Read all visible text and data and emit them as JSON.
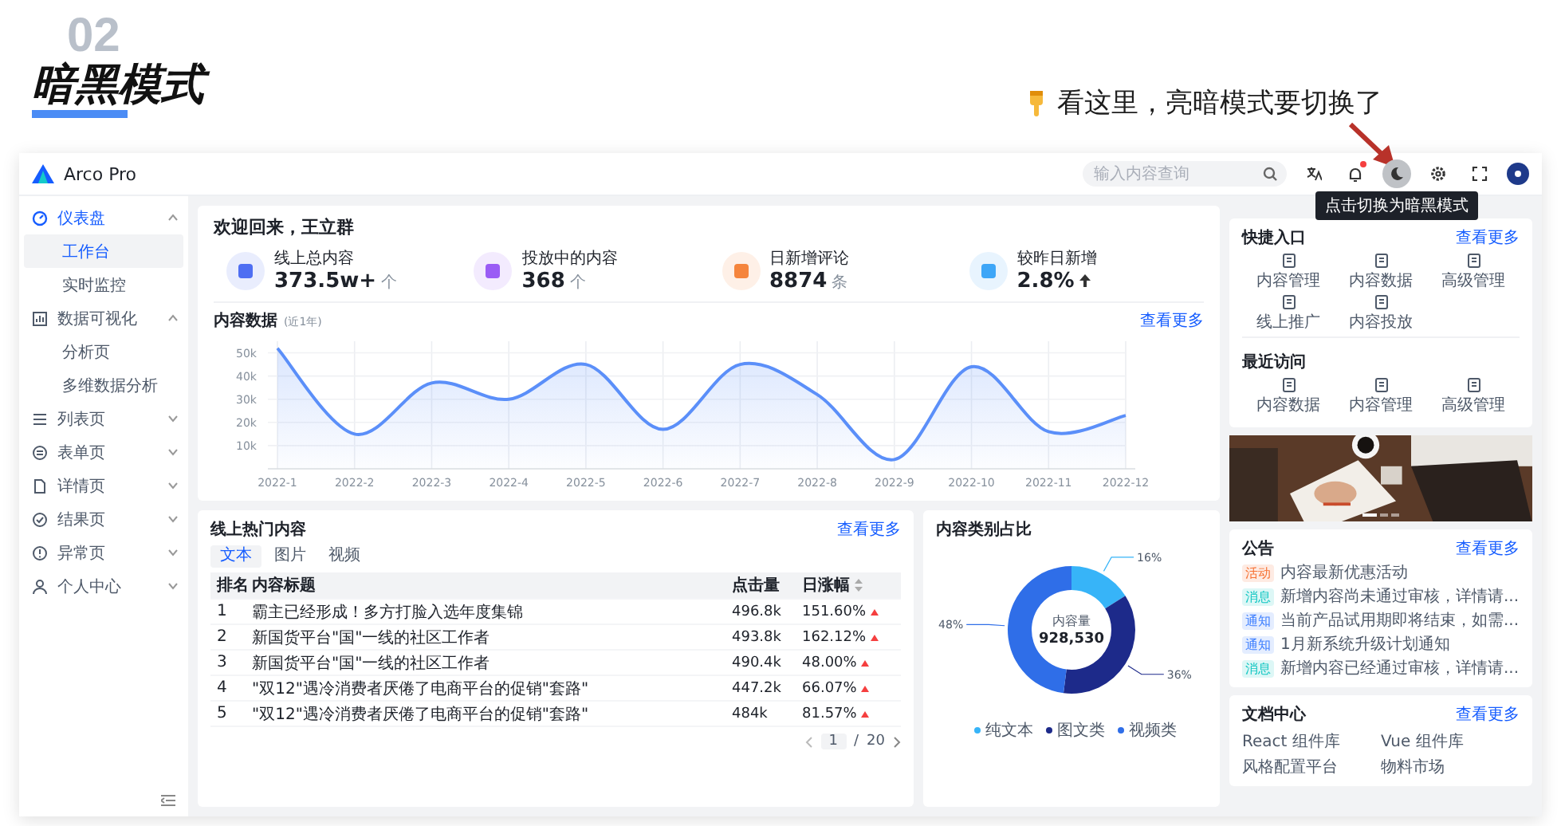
{
  "slide": {
    "section_number": "02",
    "title": "暗黑模式",
    "annotation": "看这里，亮暗模式要切换了"
  },
  "app": {
    "logo": "Arco Pro",
    "search": {
      "placeholder": "输入内容查询"
    },
    "notification_badge": true,
    "tooltip": "点击切换为暗黑模式"
  },
  "sidebar": {
    "items": [
      {
        "label": "仪表盘",
        "expanded": true,
        "children": [
          {
            "label": "工作台",
            "selected": true
          },
          {
            "label": "实时监控",
            "selected": false
          }
        ]
      },
      {
        "label": "数据可视化",
        "expanded": true,
        "children": [
          {
            "label": "分析页",
            "selected": false
          },
          {
            "label": "多维数据分析",
            "selected": false
          }
        ]
      },
      {
        "label": "列表页",
        "expanded": false
      },
      {
        "label": "表单页",
        "expanded": false
      },
      {
        "label": "详情页",
        "expanded": false
      },
      {
        "label": "结果页",
        "expanded": false
      },
      {
        "label": "异常页",
        "expanded": false
      },
      {
        "label": "个人中心",
        "expanded": false
      }
    ]
  },
  "welcome": {
    "title": "欢迎回来，王立群",
    "stats": [
      {
        "label": "线上总内容",
        "value": "373.5w+",
        "unit": "个",
        "rising": false,
        "color": "#4e6ef2"
      },
      {
        "label": "投放中的内容",
        "value": "368",
        "unit": "个",
        "rising": false,
        "color": "#9a5cf5"
      },
      {
        "label": "日新增评论",
        "value": "8874",
        "unit": "条",
        "rising": false,
        "color": "#f5853d"
      },
      {
        "label": "较昨日新增",
        "value": "2.8%",
        "rising": true,
        "color": "#3ea6f7"
      }
    ]
  },
  "content_data": {
    "title": "内容数据",
    "subtitle": "(近1年)",
    "more": "查看更多",
    "chart_data": {
      "type": "area",
      "x": [
        "2022-1",
        "2022-2",
        "2022-3",
        "2022-4",
        "2022-5",
        "2022-6",
        "2022-7",
        "2022-8",
        "2022-9",
        "2022-10",
        "2022-11",
        "2022-12"
      ],
      "grid": true,
      "series": [
        {
          "color": "#5b8ff9",
          "values": [
            52,
            15,
            37,
            30,
            45,
            17,
            45,
            32,
            4,
            44,
            16,
            23
          ]
        }
      ],
      "ylim": [
        0,
        55
      ],
      "yticks": [
        {
          "value": 10,
          "label": "10k"
        },
        {
          "value": 20,
          "label": "20k"
        },
        {
          "value": 30,
          "label": "30k"
        },
        {
          "value": 40,
          "label": "40k"
        },
        {
          "value": 50,
          "label": "50k"
        }
      ]
    }
  },
  "popular": {
    "title": "线上热门内容",
    "more": "查看更多",
    "tabs": [
      {
        "label": "文本",
        "selected": true
      },
      {
        "label": "图片",
        "selected": false
      },
      {
        "label": "视频",
        "selected": false
      }
    ],
    "columns": [
      "排名",
      "内容标题",
      "点击量",
      "日涨幅"
    ],
    "rows": [
      {
        "rank": "1",
        "title": "霸主已经形成！多方打脸入选年度集锦",
        "clicks": "496.8k",
        "growth": "151.60%",
        "rising": true
      },
      {
        "rank": "2",
        "title": "新国货平台\"国\"一线的社区工作者",
        "clicks": "493.8k",
        "growth": "162.12%",
        "rising": true
      },
      {
        "rank": "3",
        "title": "新国货平台\"国\"一线的社区工作者",
        "clicks": "490.4k",
        "growth": "48.00%",
        "rising": true
      },
      {
        "rank": "4",
        "title": "\"双12\"遇冷消费者厌倦了电商平台的促销\"套路\"",
        "clicks": "447.2k",
        "growth": "66.07%",
        "rising": true
      },
      {
        "rank": "5",
        "title": "\"双12\"遇冷消费者厌倦了电商平台的促销\"套路\"",
        "clicks": "484k",
        "growth": "81.57%",
        "rising": true
      }
    ],
    "pagination": {
      "current": "1",
      "separator": "/",
      "total": "20"
    }
  },
  "category": {
    "title": "内容类别占比",
    "center_label": "内容量",
    "center_value": "928,530",
    "chart_data": {
      "type": "donut",
      "categories": [
        "纯文本",
        "图文类",
        "视频类"
      ],
      "values": [
        16,
        36,
        48
      ],
      "value_labels": [
        "16%",
        "36%",
        "48%"
      ],
      "legend": "bottom"
    }
  },
  "quick_entry": {
    "title": "快捷入口",
    "more": "查看更多",
    "items": [
      "内容管理",
      "内容数据",
      "高级管理",
      "线上推广",
      "内容投放"
    ]
  },
  "recent": {
    "title": "最近访问",
    "items": [
      "内容数据",
      "内容管理",
      "高级管理"
    ]
  },
  "carousel": {
    "kind": "picture",
    "slides": [
      {
        "selected": true
      },
      {
        "selected": false
      },
      {
        "selected": false
      }
    ]
  },
  "notices": {
    "title": "公告",
    "more": "查看更多",
    "items": [
      {
        "tag": "活动",
        "text": "内容最新优惠活动",
        "color": "#f77234"
      },
      {
        "tag": "消息",
        "text": "新增内容尚未通过审核，详情请...",
        "color": "#0fc6c2"
      },
      {
        "tag": "通知",
        "text": "当前产品试用期即将结束，如需...",
        "color": "#3c7eff"
      },
      {
        "tag": "通知",
        "text": "1月新系统升级计划通知",
        "color": "#3c7eff"
      },
      {
        "tag": "消息",
        "text": "新增内容已经通过审核，详情请...",
        "color": "#0fc6c2"
      }
    ]
  },
  "docs": {
    "title": "文档中心",
    "more": "查看更多",
    "items": [
      "React 组件库",
      "Vue 组件库",
      "风格配置平台",
      "物料市场"
    ]
  }
}
